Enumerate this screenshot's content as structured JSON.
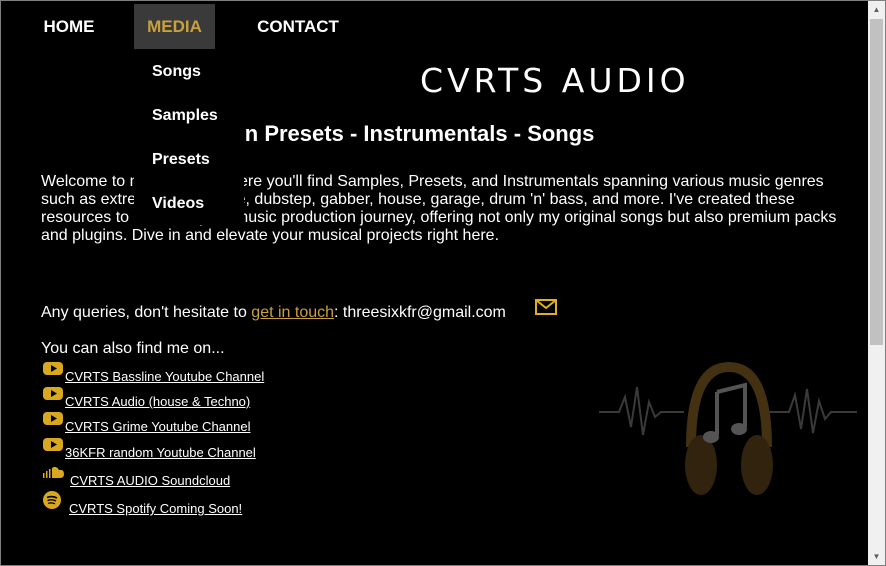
{
  "nav": {
    "home": "HOME",
    "media": "MEDIA",
    "contact": "CONTACT",
    "media_dropdown": [
      "Songs",
      "Samples",
      "Presets",
      "Videos"
    ]
  },
  "header": {
    "brand": "CVRTS AUDIO",
    "subtitle": "Plugin Presets - Instrumentals - Songs"
  },
  "intro": "Welcome to my website, where you'll find Samples, Presets, and Instrumentals spanning various music genres such as extreme bass, grime, dubstep, gabber, house, garage, drum 'n' bass, and more. I've created these resources to enhance your music production journey, offering not only my original songs but also premium packs and plugins. Dive in and elevate your musical projects right here.",
  "contact": {
    "prefix": "Any queries, don't hesitate to ",
    "link": "get in touch",
    "suffix": ": threesixkfr@gmail.com"
  },
  "findme": "You can also find me on...",
  "links": [
    {
      "label": "CVRTS Bassline Youtube Channel",
      "icon": "youtube-icon"
    },
    {
      "label": "CVRTS Audio (house & Techno)",
      "icon": "youtube-icon"
    },
    {
      "label": "CVRTS Grime Youtube Channel",
      "icon": "youtube-icon"
    },
    {
      "label": "36KFR random Youtube Channel",
      "icon": "youtube-icon"
    },
    {
      "label": "CVRTS AUDIO Soundcloud",
      "icon": "soundcloud-icon"
    },
    {
      "label": "CVRTS Spotify Coming Soon!",
      "icon": "spotify-icon"
    }
  ],
  "colors": {
    "accent": "#c8a03c",
    "background": "#000000",
    "text": "#ffffff"
  }
}
